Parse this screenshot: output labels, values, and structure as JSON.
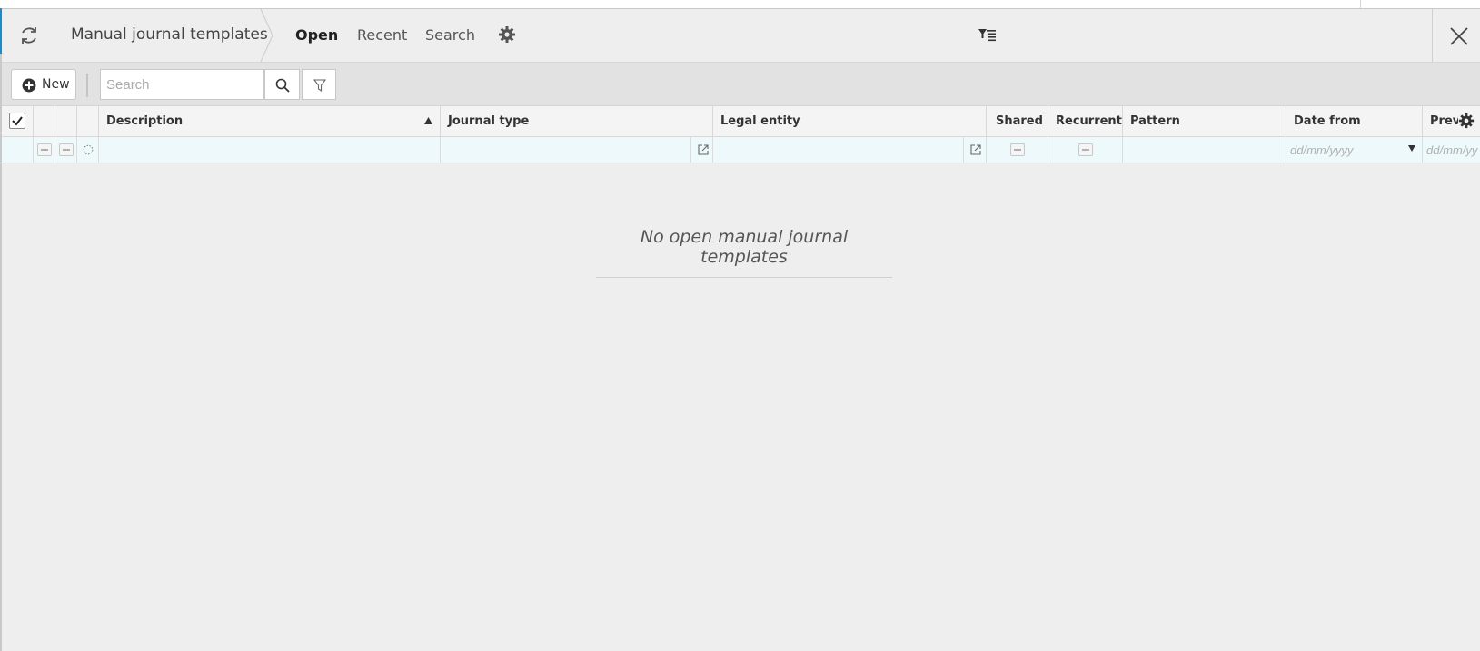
{
  "header": {
    "title": "Manual journal templates",
    "tabs": [
      {
        "label": "Open",
        "active": true
      },
      {
        "label": "Recent",
        "active": false
      },
      {
        "label": "Search",
        "active": false
      }
    ],
    "icons": [
      "refresh-icon",
      "gear-icon",
      "filter-lines-icon",
      "close-icon"
    ]
  },
  "toolbar": {
    "new_label": "New",
    "search_placeholder": "Search"
  },
  "grid": {
    "columns": [
      "Description",
      "Journal type",
      "Legal entity",
      "Shared",
      "Recurrent",
      "Pattern",
      "Date from",
      "Prev"
    ],
    "sort": {
      "column": "Description",
      "direction": "ascending"
    },
    "date_placeholder": "dd/mm/yyyy",
    "date_placeholder_truncated": "dd/mm/yy"
  },
  "empty_message": "No open manual journal templates",
  "colors": {
    "accent": "#1e8ac9",
    "background": "#eeeeee",
    "filter_row": "#eef9fb"
  }
}
